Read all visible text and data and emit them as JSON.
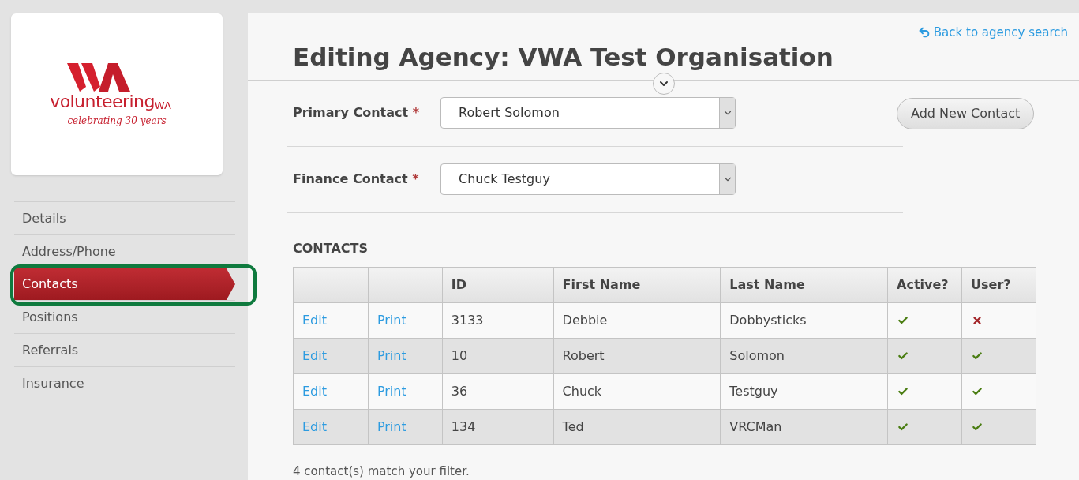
{
  "logo": {
    "wordmark": "volunteering",
    "suffix": "WA",
    "tagline": "celebrating 30 years"
  },
  "sidebar": {
    "items": [
      {
        "label": "Details",
        "selected": false
      },
      {
        "label": "Address/Phone",
        "selected": false
      },
      {
        "label": "Contacts",
        "selected": true,
        "highlighted": true
      },
      {
        "label": "Positions",
        "selected": false
      },
      {
        "label": "Referrals",
        "selected": false
      },
      {
        "label": "Insurance",
        "selected": false
      }
    ]
  },
  "header": {
    "title": "Editing Agency: VWA Test Organisation",
    "back_link": "Back to agency search"
  },
  "form": {
    "fields": [
      {
        "label": "Primary Contact",
        "required_mark": "*",
        "value": "Robert Solomon"
      },
      {
        "label": "Finance Contact",
        "required_mark": "*",
        "value": "Chuck Testguy"
      }
    ],
    "add_button": "Add New Contact"
  },
  "contacts": {
    "heading": "CONTACTS",
    "columns": [
      "ID",
      "First Name",
      "Last Name",
      "Active?",
      "User?"
    ],
    "rows": [
      {
        "edit": "Edit",
        "print": "Print",
        "id": "3133",
        "first": "Debbie",
        "last": "Dobbysticks",
        "active": true,
        "user": false
      },
      {
        "edit": "Edit",
        "print": "Print",
        "id": "10",
        "first": "Robert",
        "last": "Solomon",
        "active": true,
        "user": true
      },
      {
        "edit": "Edit",
        "print": "Print",
        "id": "36",
        "first": "Chuck",
        "last": "Testguy",
        "active": true,
        "user": true
      },
      {
        "edit": "Edit",
        "print": "Print",
        "id": "134",
        "first": "Ted",
        "last": "VRCMan",
        "active": true,
        "user": true
      }
    ],
    "footer": "4 contact(s) match your filter."
  }
}
